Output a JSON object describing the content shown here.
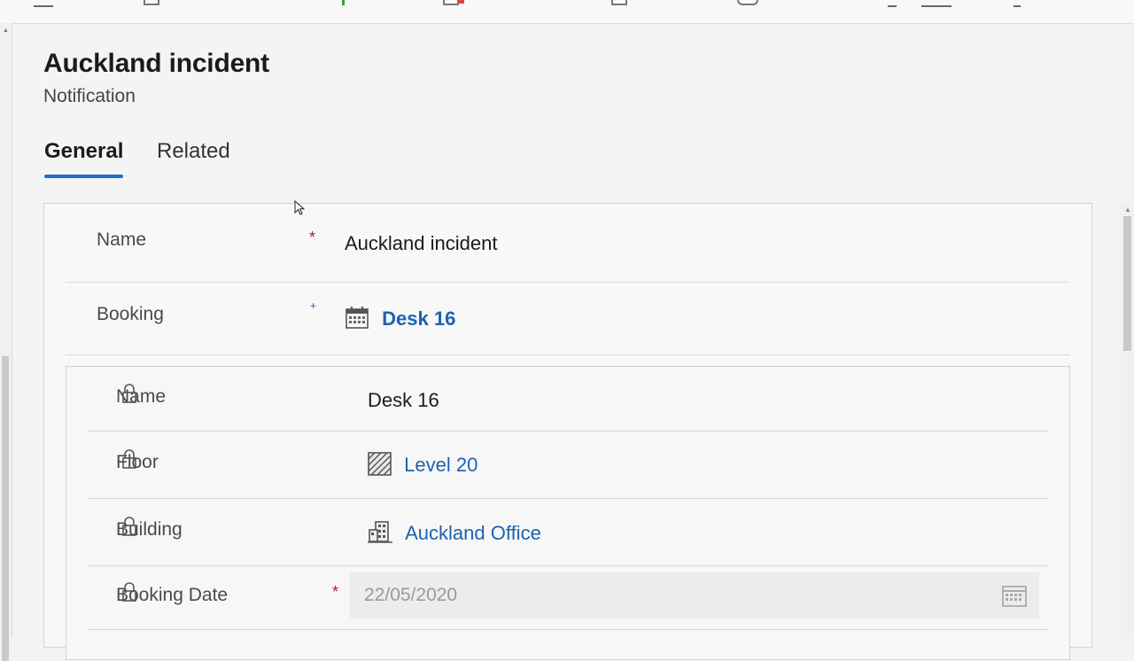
{
  "record": {
    "title": "Auckland incident",
    "entity": "Notification"
  },
  "tabs": [
    {
      "label": "General",
      "active": true
    },
    {
      "label": "Related",
      "active": false
    }
  ],
  "form": {
    "name": {
      "label": "Name",
      "value": "Auckland incident",
      "required": true
    },
    "booking": {
      "label": "Booking",
      "value": "Desk 16",
      "icon": "calendar-icon",
      "recommended": true
    }
  },
  "booking_details": {
    "name": {
      "label": "Name",
      "value": "Desk 16"
    },
    "floor": {
      "label": "Floor",
      "value": "Level 20",
      "icon": "floor-icon"
    },
    "building": {
      "label": "Building",
      "value": "Auckland Office",
      "icon": "building-icon"
    },
    "booking_date": {
      "label": "Booking Date",
      "value": "22/05/2020",
      "required": true,
      "icon": "calendar-icon"
    }
  },
  "colors": {
    "accent": "#1e6fd1",
    "link": "#1c63b0",
    "required": "#a4262c"
  }
}
